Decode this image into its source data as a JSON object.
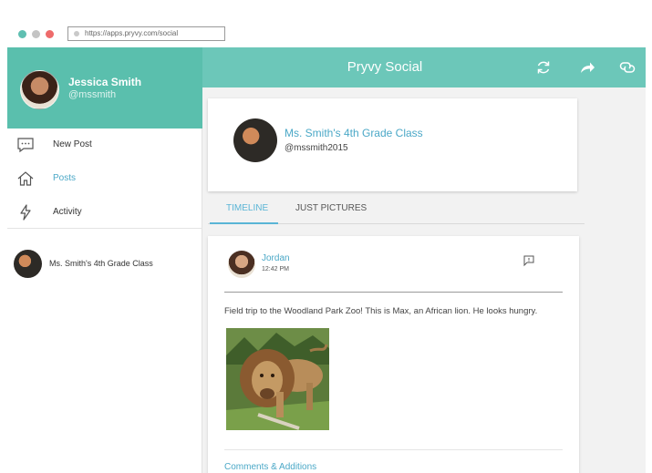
{
  "browser": {
    "url": "https://apps.pryvy.com/social"
  },
  "profile": {
    "name": "Jessica Smith",
    "handle": "@mssmith"
  },
  "sidebar": {
    "items": [
      {
        "label": "New Post",
        "icon": "chat-bubble-icon"
      },
      {
        "label": "Posts",
        "icon": "home-icon",
        "active": true
      },
      {
        "label": "Activity",
        "icon": "lightning-icon"
      }
    ],
    "groups": [
      {
        "label": "Ms. Smith's 4th Grade Class"
      }
    ]
  },
  "header": {
    "title": "Pryvy Social",
    "icons": [
      "refresh-icon",
      "share-icon",
      "link-icon"
    ]
  },
  "group": {
    "name": "Ms. Smith's 4th Grade Class",
    "handle": "@mssmith2015"
  },
  "tabs": [
    {
      "label": "TIMELINE",
      "active": true
    },
    {
      "label": "JUST PICTURES",
      "active": false
    }
  ],
  "post": {
    "author": "Jordan",
    "time": "12:42 PM",
    "text": "Field trip to the Woodland Park Zoo!  This is Max, an African lion.  He looks hungry.",
    "comments_label": "Comments & Additions"
  },
  "colors": {
    "accent": "#5abfad",
    "header": "#6cc7b9",
    "link": "#4ba8c7"
  }
}
